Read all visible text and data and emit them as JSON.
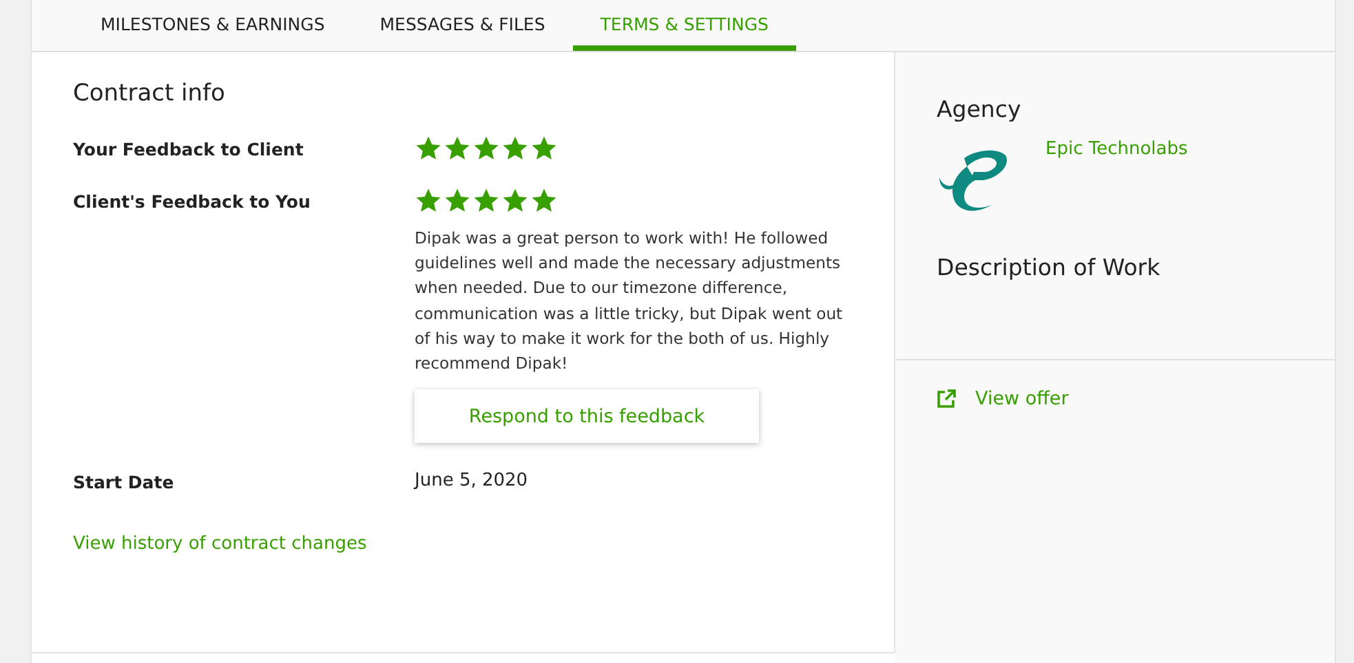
{
  "tabs": [
    {
      "label": "MILESTONES & EARNINGS",
      "selected": false
    },
    {
      "label": "MESSAGES & FILES",
      "selected": false
    },
    {
      "label": "TERMS & SETTINGS",
      "selected": true
    }
  ],
  "contract_info": {
    "title": "Contract info",
    "rows": [
      {
        "kind": "rating",
        "label": "Your Feedback to Client",
        "stars": 5
      },
      {
        "kind": "rating",
        "label": "Client's Feedback to You",
        "stars": 5,
        "comment": "Dipak was a great person to work with! He followed guidelines well and made the necessary adjustments when needed. Due to our timezone difference, communication was a little tricky, but Dipak went out of his way to make it work for the both of us. Highly recommend Dipak!",
        "button": "Respond to this feedback"
      },
      {
        "kind": "text",
        "label": "Start Date",
        "value": "June 5, 2020"
      }
    ],
    "history_link": "View history of contract changes"
  },
  "sidebar": {
    "agency_title": "Agency",
    "agency_name": "Epic Technolabs",
    "description_title": "Description of Work",
    "view_offer": "View offer"
  }
}
